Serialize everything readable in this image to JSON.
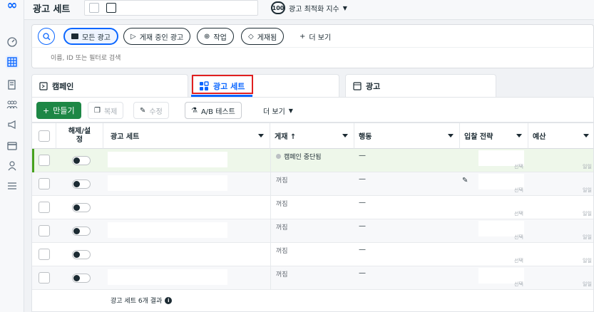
{
  "header": {
    "title": "광고 세트",
    "optimization_score": "100",
    "optimization_label": "광고 최적화 지수"
  },
  "filters": {
    "all_ads": "모든 광고",
    "published_ads": "게재 중인 광고",
    "actions": "작업",
    "delivered": "게재됨",
    "more": "더 보기",
    "search_placeholder": "이름, ID 또는 필터로 검색"
  },
  "tabs": [
    {
      "label": "캠페인"
    },
    {
      "label": "광고 세트"
    },
    {
      "label": "광고"
    }
  ],
  "toolbar": {
    "create": "만들기",
    "duplicate": "복제",
    "edit": "수정",
    "ab_test": "A/B 테스트",
    "more": "더 보기"
  },
  "table": {
    "columns": {
      "toggle": "해제/설정",
      "name": "광고 세트",
      "delivery": "게재 ↑",
      "action": "행동",
      "bid_strategy": "입찰 전략",
      "budget": "예산"
    },
    "rows": [
      {
        "status": "캠페인 중단됨",
        "action": "—",
        "bid_sub": "선택",
        "budget_sub": "일일"
      },
      {
        "status": "꺼짐",
        "action": "—",
        "bid_sub": "선택",
        "budget_sub": "일일"
      },
      {
        "status": "꺼짐",
        "action": "—",
        "bid_sub": "선택",
        "budget_sub": "일일"
      },
      {
        "status": "꺼짐",
        "action": "—",
        "bid_sub": "선택",
        "budget_sub": "일일"
      },
      {
        "status": "꺼짐",
        "action": "—",
        "bid_sub": "선택",
        "budget_sub": "일일"
      },
      {
        "status": "꺼짐",
        "action": "—",
        "bid_sub": "선택",
        "budget_sub": "일일"
      }
    ],
    "footer": "광고 세트 6개 결과"
  },
  "colors": {
    "accent": "#0a66ff",
    "create_green": "#1d8745",
    "highlight_red": "#e02020"
  }
}
